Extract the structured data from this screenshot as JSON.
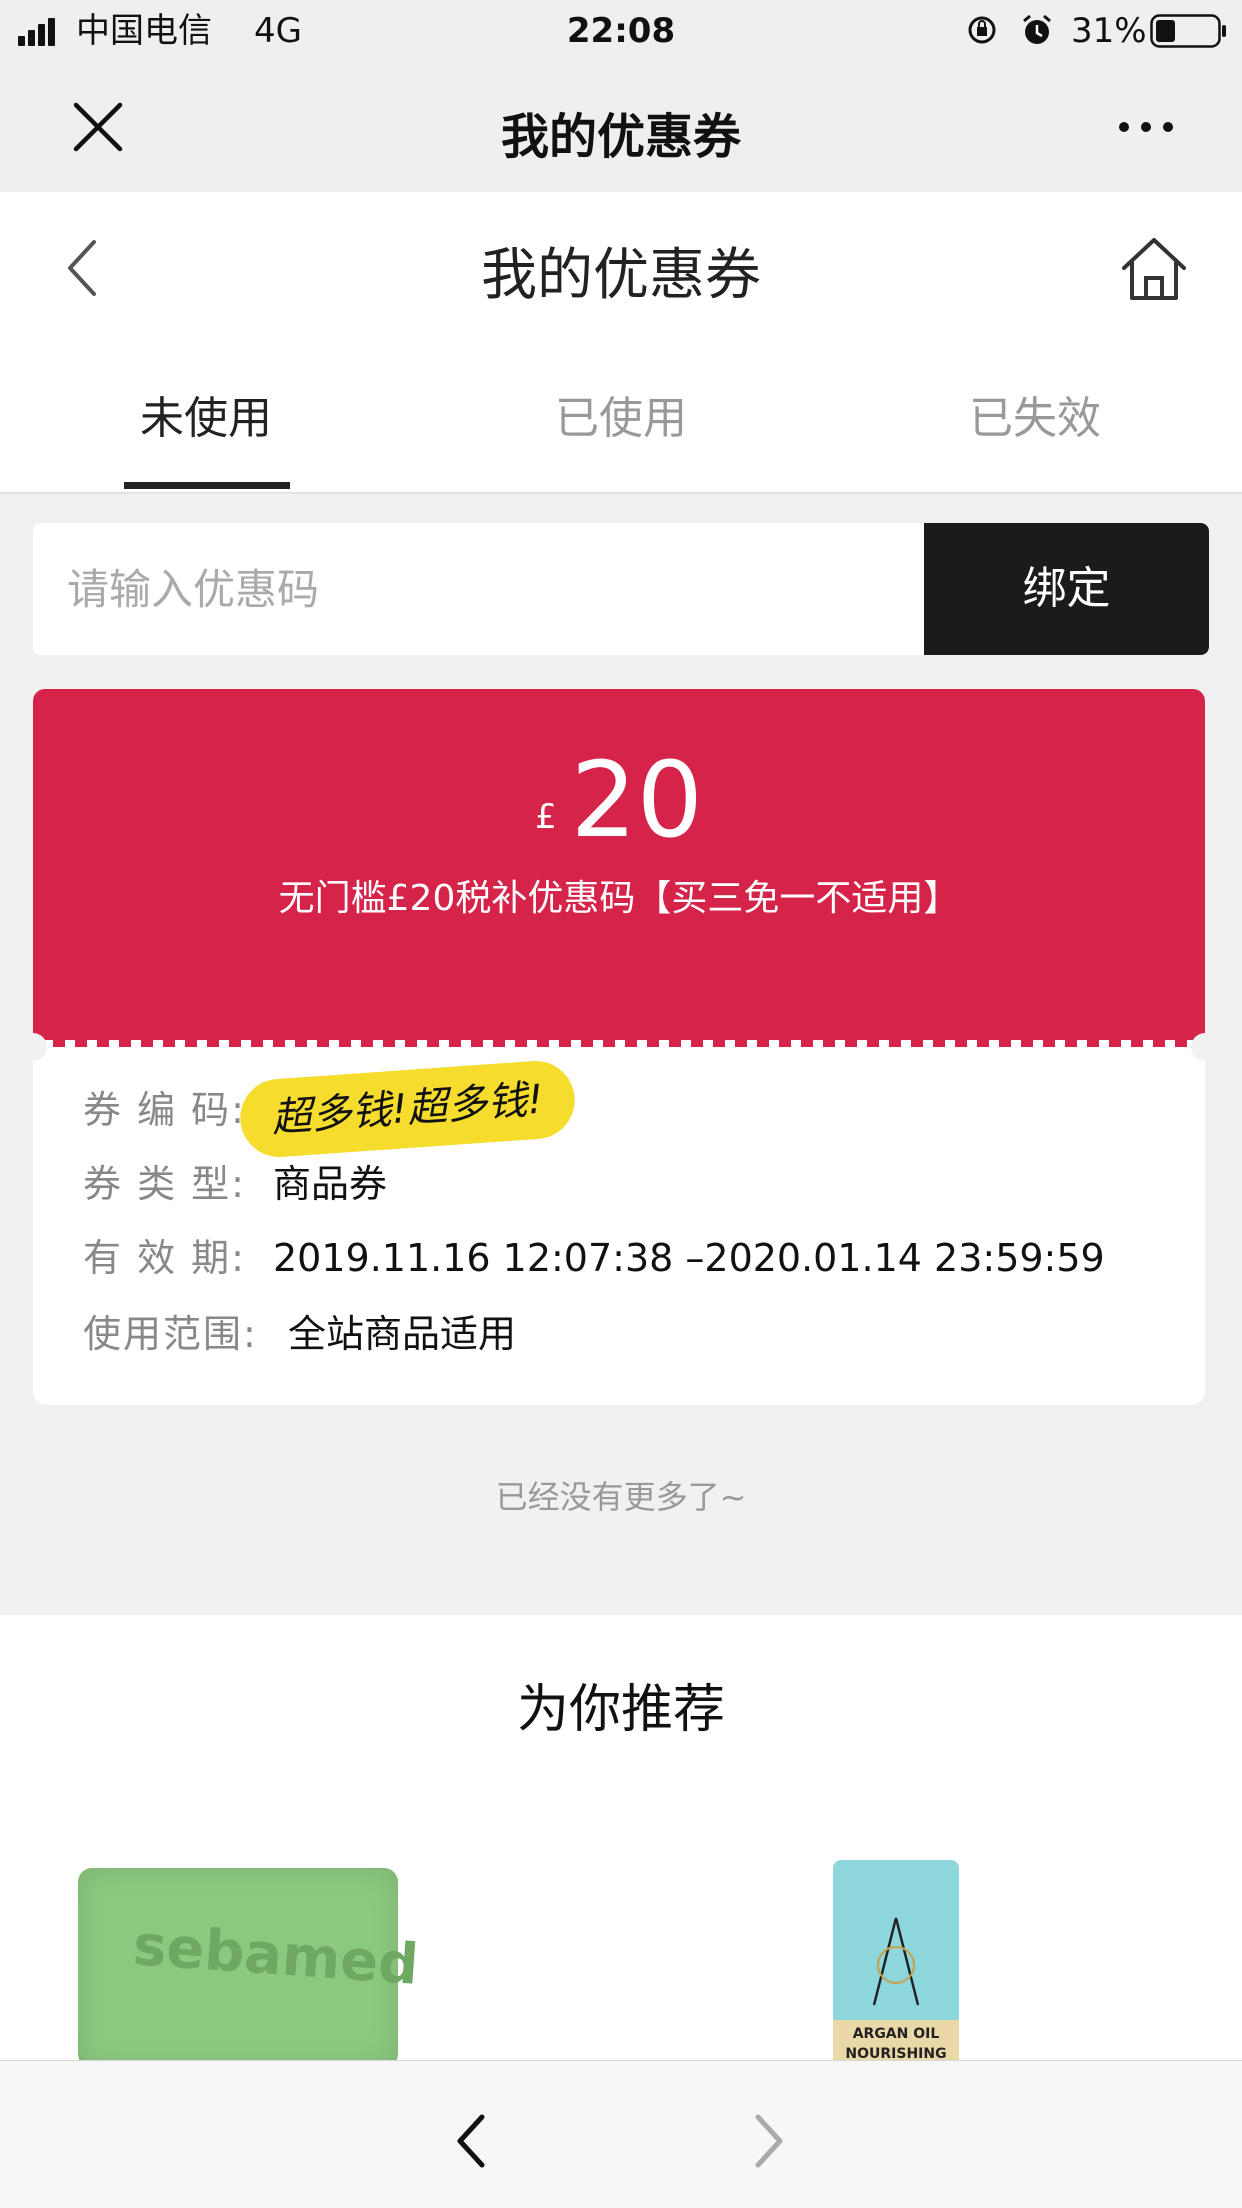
{
  "status_bar": {
    "carrier": "中国电信",
    "network": "4G",
    "time": "22:08",
    "battery_percent": "31%",
    "battery_level": 0.31
  },
  "navbar": {
    "title": "我的优惠券"
  },
  "page_header": {
    "title": "我的优惠券",
    "tabs": [
      {
        "label": "未使用",
        "active": true
      },
      {
        "label": "已使用",
        "active": false
      },
      {
        "label": "已失效",
        "active": false
      }
    ]
  },
  "bind": {
    "placeholder": "请输入优惠码",
    "button_label": "绑定"
  },
  "coupon": {
    "currency": "£",
    "amount": "20",
    "description": "无门槛£20税补优惠码【买三免一不适用】",
    "code_label": "券 编 码:",
    "code_sticker": "超多钱!超多钱!",
    "type_label": "券 类 型:",
    "type_value": "商品券",
    "validity_label": "有 效 期:",
    "validity_value": "2019.11.16 12:07:38 –2020.01.14 23:59:59",
    "scope_label": "使用范围:",
    "scope_value": "全站商品适用",
    "accent_color": "#d62349"
  },
  "list_end_text": "已经没有更多了~",
  "recommend": {
    "title": "为你推荐",
    "products": [
      {
        "label": "sebamed"
      },
      {
        "label": "ARGAN OIL NOURISHING"
      }
    ]
  }
}
